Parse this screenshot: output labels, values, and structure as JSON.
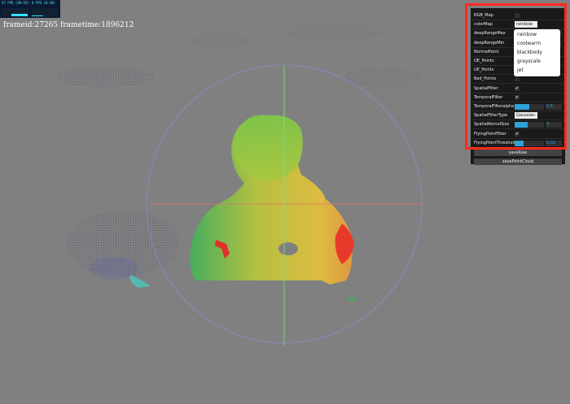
{
  "fps": {
    "fps_label": "37 FPS (20-55)",
    "ms_label": "6 FPS (0-10)"
  },
  "frame_info": "frameid:27265 frametime:1896212",
  "gui": {
    "rows": [
      {
        "label": "RGB_Map",
        "type": "checkbox",
        "checked": false
      },
      {
        "label": "colorMap",
        "type": "select",
        "value": "rainbow"
      },
      {
        "label": "deepRangeMax",
        "type": "slider",
        "value": ""
      },
      {
        "label": "deepRangeMin",
        "type": "slider",
        "value": ""
      },
      {
        "label": "NormalPoint",
        "type": "checkbox",
        "checked": false
      },
      {
        "label": "OE_Points",
        "type": "checkbox",
        "checked": false
      },
      {
        "label": "UE_Points",
        "type": "checkbox",
        "checked": false
      },
      {
        "label": "Bad_Points",
        "type": "checkbox",
        "checked": false
      },
      {
        "label": "SpatialFilter",
        "type": "checkbox",
        "checked": true
      },
      {
        "label": "TemporalFilter",
        "type": "checkbox",
        "checked": true
      },
      {
        "label": "TemporalFilteralpha",
        "type": "slider",
        "value": "0.5",
        "fraction": 0.5
      },
      {
        "label": "SpatialFilterType",
        "type": "select",
        "value": "Gaussian"
      },
      {
        "label": "SpatialKernelSize",
        "type": "slider",
        "value": "3",
        "fraction": 0.45
      },
      {
        "label": "FlyingPointFilter",
        "type": "checkbox",
        "checked": true
      },
      {
        "label": "FlyingPointThreshold",
        "type": "slider",
        "value": "0.02",
        "fraction": 0.3
      }
    ],
    "buttons": [
      "saveRaw",
      "savePointCloud"
    ]
  },
  "dropdown": {
    "options": [
      "rainbow",
      "coolwarm",
      "blackbody",
      "grayscale",
      "jet"
    ]
  },
  "colors": {
    "highlight_border": "#ff2a1c",
    "panel_bg": "#1a1a1a",
    "viewport_bg": "#808080",
    "slider_accent": "#2fa1d6"
  }
}
